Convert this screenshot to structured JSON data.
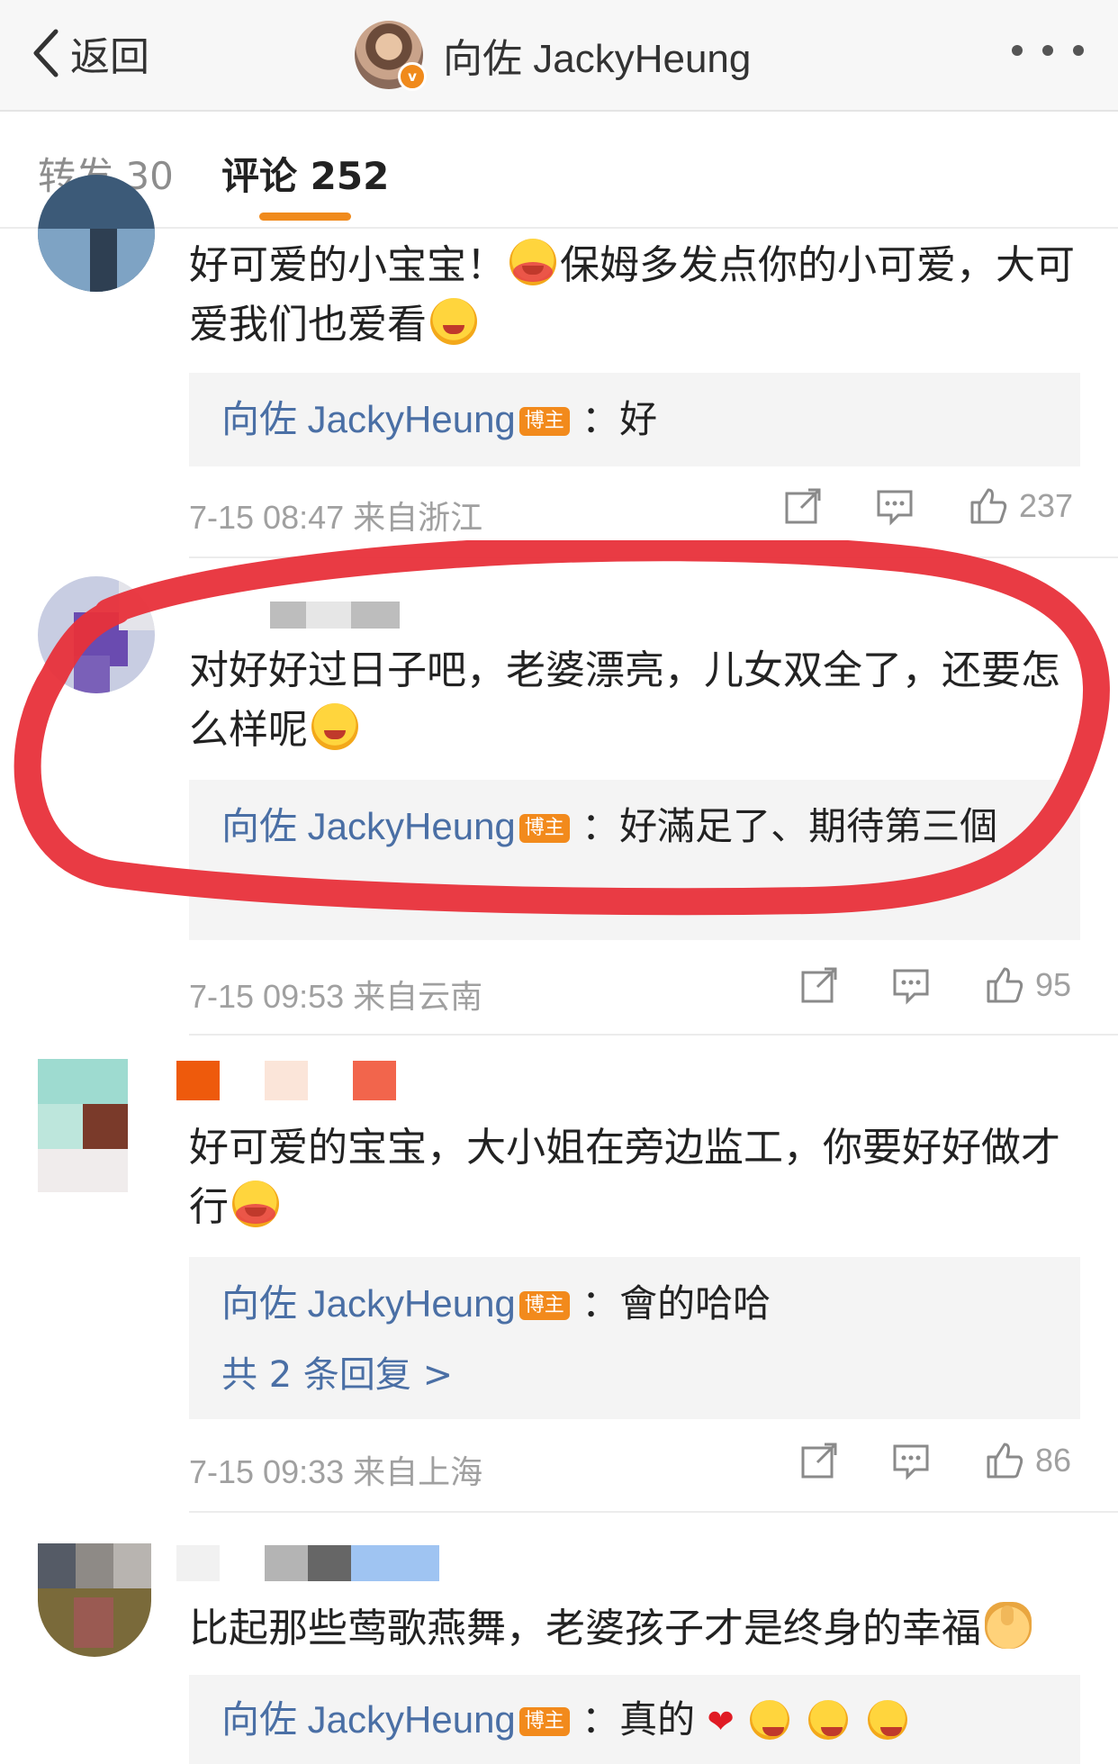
{
  "header": {
    "back_label": "返回",
    "title": "向佐 JackyHeung",
    "verified_mark": "v"
  },
  "tabs": {
    "repost": "转发 30",
    "comments": "评论 252"
  },
  "colors": {
    "accent": "#f08a1c",
    "link": "#4a6fa5",
    "annotation": "#e8303a"
  },
  "host_badge": "博主",
  "comments": [
    {
      "text": "好可爱的小宝宝！",
      "text_after_emoji": "保姆多发点你的小可爱，大可爱我们也爱看",
      "emoji": [
        "screaming-face",
        "hugging-face"
      ],
      "reply_author": "向佐 JackyHeung",
      "reply_text": "：好",
      "time": "7-15 08:47",
      "location": "来自浙江",
      "likes": "237"
    },
    {
      "text": "对好好过日子吧，老婆漂亮，儿女双全了，还要怎么样呢",
      "emoji": [
        "shy-face"
      ],
      "reply_author": "向佐 JackyHeung",
      "reply_text": "：好滿足了、期待第三個",
      "time": "7-15 09:53",
      "location": "来自云南",
      "likes": "95"
    },
    {
      "text": "好可爱的宝宝，大小姐在旁边监工，你要好好做才行",
      "emoji": [
        "screaming-face"
      ],
      "reply_author": "向佐 JackyHeung",
      "reply_text": "：會的哈哈",
      "more_replies": "共 2 条回复 >",
      "time": "7-15 09:33",
      "location": "来自上海",
      "likes": "86"
    },
    {
      "text": "比起那些莺歌燕舞，老婆孩子才是终身的幸福",
      "emoji": [
        "thumbs-up"
      ],
      "reply_author": "向佐 JackyHeung",
      "reply_text": "：真的",
      "reply_emoji": [
        "red-heart",
        "clapping-hands",
        "clapping-hands",
        "clapping-hands"
      ]
    }
  ]
}
